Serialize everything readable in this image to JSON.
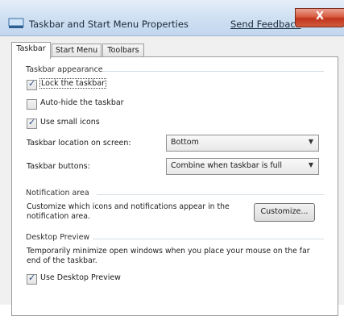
{
  "window": {
    "title": "Taskbar and Start Menu Properties",
    "send_feedback": "Send Feedback",
    "close_glyph": "X"
  },
  "tabs": [
    {
      "label": "Taskbar",
      "active": true
    },
    {
      "label": "Start Menu",
      "active": false
    },
    {
      "label": "Toolbars",
      "active": false
    }
  ],
  "appearance": {
    "heading": "Taskbar appearance",
    "options": [
      {
        "label": "Lock the taskbar",
        "checked": true
      },
      {
        "label": "Auto-hide the taskbar",
        "checked": false
      },
      {
        "label": "Use small icons",
        "checked": true
      }
    ],
    "location_label": "Taskbar location on screen:",
    "location_value": "Bottom",
    "buttons_label": "Taskbar buttons:",
    "buttons_value": "Combine when taskbar is full"
  },
  "notification": {
    "heading": "Notification area",
    "text": "Customize which icons and notifications appear in the notification area.",
    "customize_label": "Customize..."
  },
  "desktop_preview": {
    "heading": "Desktop Preview",
    "text": "Temporarily minimize open windows when you place your mouse on the far end of the taskbar.",
    "option": {
      "label": "Use Desktop Preview",
      "checked": true
    }
  },
  "icons": {
    "checkmark": "✓",
    "dropdown": "▼"
  }
}
